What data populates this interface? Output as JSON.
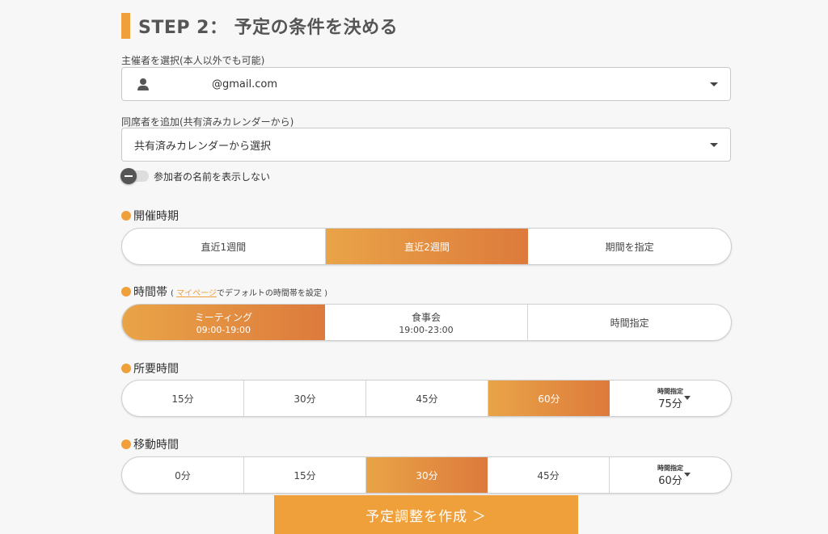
{
  "header": {
    "title": "STEP 2： 予定の条件を決める"
  },
  "organizer": {
    "label": "主催者を選択(本人以外でも可能)",
    "value": "@gmail.com"
  },
  "attendees": {
    "label": "同席者を追加(共有済みカレンダーから)",
    "value": "共有済みカレンダーから選択"
  },
  "hide_names_toggle": {
    "label": "参加者の名前を表示しない",
    "checked": false
  },
  "period": {
    "title": "開催時期",
    "options": [
      {
        "label": "直近1週間",
        "active": false
      },
      {
        "label": "直近2週間",
        "active": true
      },
      {
        "label": "期間を指定",
        "active": false
      }
    ]
  },
  "timeslot": {
    "title": "時間帯",
    "note_open": "( ",
    "note_link": "マイページ",
    "note_rest": "でデフォルトの時間帯を設定 )",
    "options": [
      {
        "label": "ミーティング",
        "sub": "09:00-19:00",
        "active": true
      },
      {
        "label": "食事会",
        "sub": "19:00-23:00",
        "active": false
      },
      {
        "label": "時間指定",
        "sub": "",
        "active": false
      }
    ]
  },
  "duration": {
    "title": "所要時間",
    "options": [
      {
        "label": "15分",
        "active": false
      },
      {
        "label": "30分",
        "active": false
      },
      {
        "label": "45分",
        "active": false
      },
      {
        "label": "60分",
        "active": true
      }
    ],
    "custom": {
      "small_label": "時間指定",
      "value": "75分"
    }
  },
  "travel": {
    "title": "移動時間",
    "options": [
      {
        "label": "0分",
        "active": false
      },
      {
        "label": "15分",
        "active": false
      },
      {
        "label": "30分",
        "active": true
      },
      {
        "label": "45分",
        "active": false
      }
    ],
    "custom": {
      "small_label": "時間指定",
      "value": "60分"
    }
  },
  "submit": {
    "label": "予定調整を作成 ＞"
  },
  "colors": {
    "accent": "#f0a03a",
    "active_gradient_start": "#e9a447",
    "active_gradient_end": "#dd7a3c"
  }
}
